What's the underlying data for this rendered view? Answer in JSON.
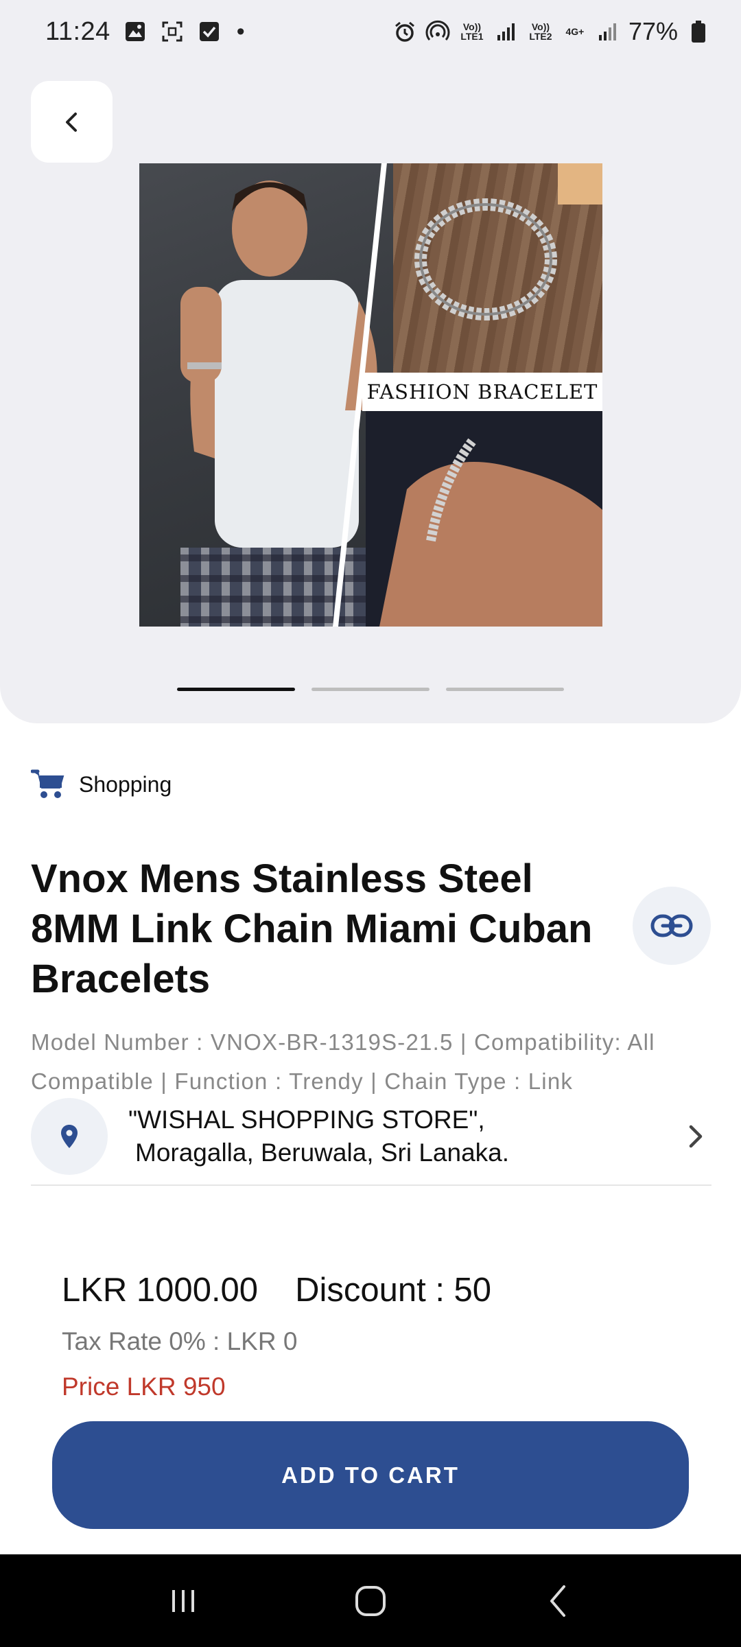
{
  "status_bar": {
    "time": "11:24",
    "dot": "•",
    "battery_percent": "77%",
    "lte1": "Vo)) LTE1",
    "lte2": "Vo)) LTE2",
    "net": "4G+",
    "icons": [
      "gallery-icon",
      "screenshot-icon",
      "checkbox-icon",
      "alarm-icon",
      "hotspot-icon",
      "signal-icon",
      "battery-icon"
    ]
  },
  "product": {
    "image_label": "FASHION BRACELET",
    "carousel": {
      "count": 3,
      "active_index": 0
    },
    "category": "Shopping",
    "title": "Vnox Mens Stainless Steel 8MM Link Chain Miami Cuban Bracelets",
    "specs": "Model Number : VNOX-BR-1319S-21.5 | Compatibility: All Compatible | Function : Trendy | Chain Type : Link"
  },
  "store": {
    "line1": "\"WISHAL SHOPPING STORE\",",
    "line2": "Moragalla, Beruwala, Sri Lanaka."
  },
  "pricing": {
    "price": "LKR 1000.00",
    "discount": "Discount : 50",
    "tax": "Tax Rate 0% : LKR 0",
    "final_price": "Price LKR 950"
  },
  "actions": {
    "add_to_cart": "ADD TO CART"
  },
  "colors": {
    "primary": "#2d4e91",
    "price_red": "#c0392b",
    "hero_bg": "#efeff3"
  }
}
